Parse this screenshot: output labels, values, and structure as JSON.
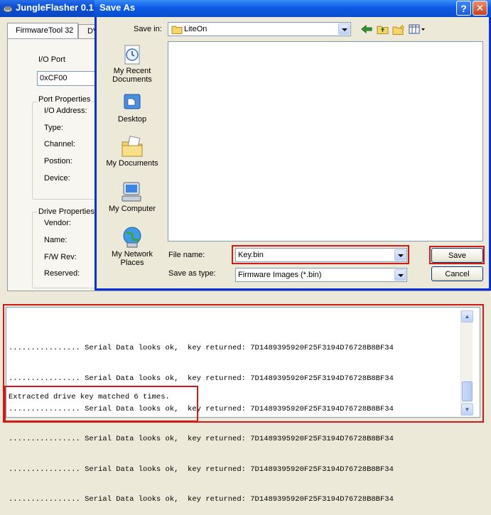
{
  "background_window": {
    "title": "JungleFlasher 0.1",
    "tabs": [
      "FirmwareTool 32",
      "DVD"
    ],
    "io_port": {
      "label": "I/O Port",
      "value": "0xCF00"
    },
    "port_properties": {
      "title": "Port Properties",
      "fields": [
        "I/O Address:",
        "Type:",
        "Channel:",
        "Postion:",
        "Device:"
      ]
    },
    "drive_properties": {
      "title": "Drive Properties",
      "fields": [
        "Vendor:",
        "Name:",
        "F/W Rev:",
        "Reserved:"
      ]
    }
  },
  "log": {
    "lines": [
      "................ Serial Data looks ok,  key returned: 7D1489395920F25F3194D76728B8BF34",
      "................ Serial Data looks ok,  key returned: 7D1489395920F25F3194D76728B8BF34",
      "................ Serial Data looks ok,  key returned: 7D1489395920F25F3194D76728B8BF34",
      "................ Serial Data looks ok,  key returned: 7D1489395920F25F3194D76728B8BF34",
      "................ Serial Data looks ok,  key returned: 7D1489395920F25F3194D76728B8BF34",
      "................ Serial Data looks ok,  key returned: 7D1489395920F25F3194D76728B8BF34"
    ],
    "summary": "Extracted drive key matched 6 times."
  },
  "dialog": {
    "title": "Save As",
    "save_in_label": "Save in:",
    "save_in_value": "LiteOn",
    "places": [
      "My Recent\nDocuments",
      "Desktop",
      "My Documents",
      "My Computer",
      "My Network\nPlaces"
    ],
    "file_name_label": "File name:",
    "file_name_value": "Key.bin",
    "save_type_label": "Save as type:",
    "save_type_value": "Firmware Images (*.bin)",
    "save_label": "Save",
    "cancel_label": "Cancel",
    "help_label": "?",
    "close_label": "✕"
  },
  "colors": {
    "annotation_red": "#d11a1a",
    "xp_title_blue": "#0a4fd6",
    "dialog_border": "#0831d9"
  }
}
